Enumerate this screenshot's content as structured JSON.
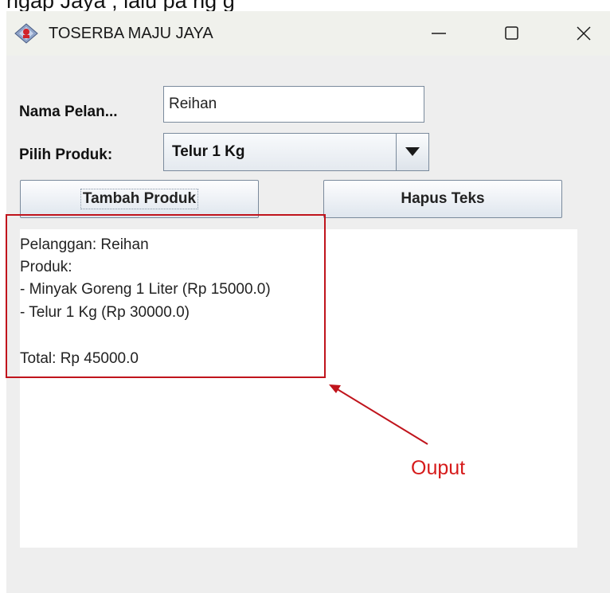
{
  "top_strip_text": "ngap                       Jaya        , lalu  pa  ng  g",
  "window": {
    "title": "TOSERBA MAJU JAYA",
    "icon": "java-app-icon",
    "controls": {
      "minimize_icon": "minimize-icon",
      "maximize_icon": "maximize-icon",
      "close_icon": "close-icon"
    }
  },
  "form": {
    "name_label": "Nama Pelan...",
    "name_value": "Reihan",
    "product_label": "Pilih Produk:",
    "product_selected": "Telur 1 Kg"
  },
  "buttons": {
    "add": "Tambah Produk",
    "clear": "Hapus Teks"
  },
  "output": {
    "lines": [
      "Pelanggan: Reihan",
      "Produk:",
      "- Minyak Goreng 1 Liter (Rp 15000.0)",
      "- Telur 1 Kg (Rp 30000.0)",
      "Total: Rp 45000.0"
    ]
  },
  "annotation": {
    "label": "Ouput",
    "color": "#d61a1a"
  }
}
